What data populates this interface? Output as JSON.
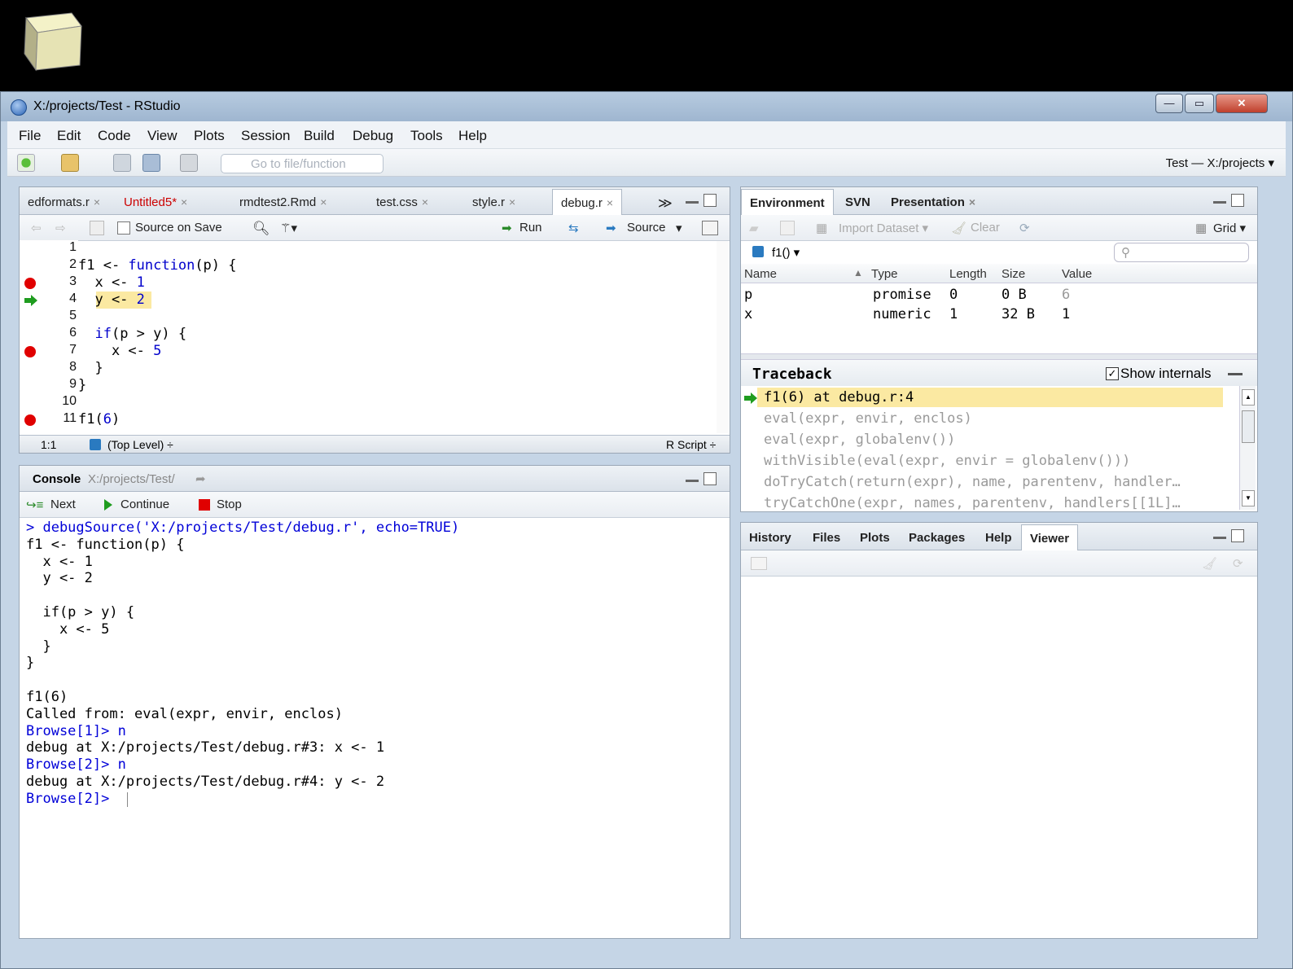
{
  "window": {
    "title": "X:/projects/Test - RStudio",
    "min": "—",
    "max": "▭",
    "close": "✕"
  },
  "menu": [
    "File",
    "Edit",
    "Code",
    "View",
    "Plots",
    "Session",
    "Build",
    "Debug",
    "Tools",
    "Help"
  ],
  "toolbar": {
    "goto_placeholder": "Go to file/function",
    "project": "Test — X:/projects ▾"
  },
  "editor": {
    "tabs": [
      {
        "label": "edformats.r",
        "close": "×"
      },
      {
        "label": "Untitled5*",
        "close": "×"
      },
      {
        "label": "rmdtest2.Rmd",
        "close": "×"
      },
      {
        "label": "test.css",
        "close": "×"
      },
      {
        "label": "style.r",
        "close": "×"
      },
      {
        "label": "debug.r",
        "close": "×"
      }
    ],
    "overflow": "≫",
    "source_on_save": "Source on Save",
    "run_label": "Run",
    "source_label": "Source",
    "line_numbers": [
      "1",
      "2",
      "3",
      "4",
      "5",
      "6",
      "7",
      "8",
      "9",
      "10",
      "11"
    ],
    "code_lines": [
      "",
      "f1 <- function(p) {",
      "  x <- 1",
      "  y <- 2",
      "",
      "  if(p > y) {",
      "    x <- 5",
      "  }",
      "}",
      "",
      "f1(6)"
    ],
    "status_position": "1:1",
    "status_scope": "(Top Level) ÷",
    "status_type": "R Script ÷"
  },
  "console": {
    "title": "Console",
    "path": "X:/projects/Test/",
    "next_label": "Next",
    "continue_label": "Continue",
    "stop_label": "Stop",
    "lines": [
      {
        "text": "> debugSource('X:/projects/Test/debug.r', echo=TRUE)",
        "color": "blue"
      },
      {
        "text": "f1 <- function(p) {",
        "color": "black"
      },
      {
        "text": "  x <- 1",
        "color": "black"
      },
      {
        "text": "  y <- 2",
        "color": "black"
      },
      {
        "text": "",
        "color": "black"
      },
      {
        "text": "  if(p > y) {",
        "color": "black"
      },
      {
        "text": "    x <- 5",
        "color": "black"
      },
      {
        "text": "  }",
        "color": "black"
      },
      {
        "text": "}",
        "color": "black"
      },
      {
        "text": "",
        "color": "black"
      },
      {
        "text": "f1(6)",
        "color": "black"
      },
      {
        "text": "Called from: eval(expr, envir, enclos)",
        "color": "black"
      },
      {
        "text": "Browse[1]> n",
        "color": "blue"
      },
      {
        "text": "debug at X:/projects/Test/debug.r#3: x <- 1",
        "color": "black"
      },
      {
        "text": "Browse[2]> n",
        "color": "blue"
      },
      {
        "text": "debug at X:/projects/Test/debug.r#4: y <- 2",
        "color": "black"
      },
      {
        "text": "Browse[2]> ",
        "color": "blue"
      }
    ]
  },
  "environment": {
    "tabs": [
      "Environment",
      "SVN",
      "Presentation"
    ],
    "presentation_close": "×",
    "import_label": "Import Dataset ▾",
    "clear_label": "Clear",
    "grid_label": "Grid ▾",
    "frame_label": "f1() ▾",
    "columns": [
      "Name",
      "Type",
      "Length",
      "Size",
      "Value"
    ],
    "rows": [
      {
        "name": "p",
        "type": "promise",
        "length": "0",
        "size": "0 B",
        "value": "6"
      },
      {
        "name": "x",
        "type": "numeric",
        "length": "1",
        "size": "32 B",
        "value": "1"
      }
    ]
  },
  "traceback": {
    "title": "Traceback",
    "show_internals": "Show internals",
    "lines": [
      "f1(6) at debug.r:4",
      "eval(expr, envir, enclos)",
      "eval(expr, globalenv())",
      "withVisible(eval(expr, envir = globalenv()))",
      "doTryCatch(return(expr), name, parentenv, handler…",
      "tryCatchOne(expr, names, parentenv, handlers[[1L]…"
    ]
  },
  "viewer": {
    "tabs": [
      "History",
      "Files",
      "Plots",
      "Packages",
      "Help",
      "Viewer"
    ]
  }
}
